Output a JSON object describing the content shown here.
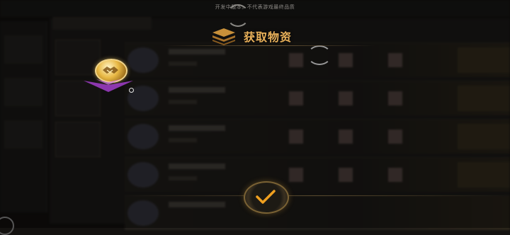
{
  "notice": {
    "dev_text": "开发中版本，不代表游戏最终品质"
  },
  "dialog": {
    "title": "获取物资"
  },
  "icons": {
    "title_icon": "stacked-supplies-icon",
    "medal": "handshake-medal-icon",
    "confirm": "checkmark-icon",
    "loading": "loading-spinner-icon"
  },
  "colors": {
    "accent": "#e9b15a",
    "confirm_check": "#f0a020",
    "medal_purple": "#b84fd1"
  }
}
